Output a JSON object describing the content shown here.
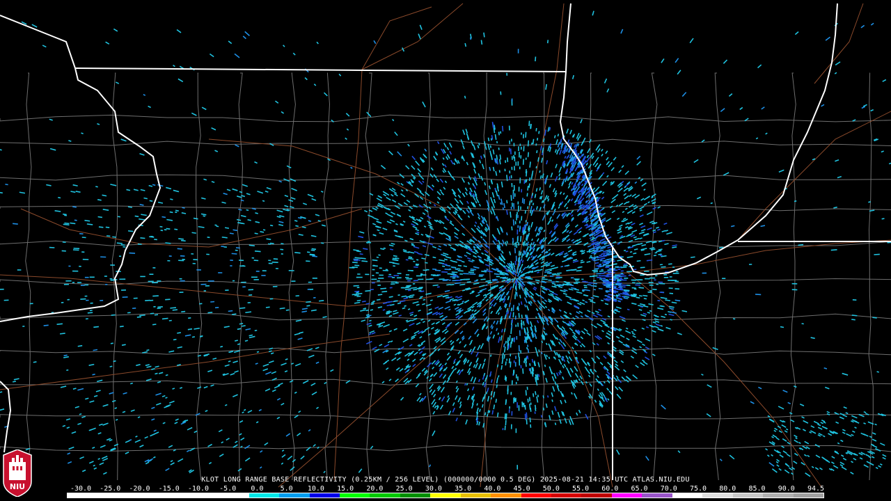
{
  "caption": "KLOT LONG RANGE BASE REFLECTIVITY (0.25KM / 256 LEVEL) (000000/0000 0.5 DEG) 2025-08-21 14:35 UTC  ATLAS.NIU.EDU",
  "scale": {
    "labels": [
      "-30.0",
      "-25.0",
      "-20.0",
      "-15.0",
      "-10.0",
      "-5.0",
      "0.0",
      "5.0",
      "10.0",
      "15.0",
      "20.0",
      "25.0",
      "30.0",
      "35.0",
      "40.0",
      "45.0",
      "50.0",
      "55.0",
      "60.0",
      "65.0",
      "70.0",
      "75.0",
      "80.0",
      "85.0",
      "90.0",
      "94.5"
    ],
    "colors": [
      "#ffffff",
      "#ffffff",
      "#ffffff",
      "#ffffff",
      "#ffffff",
      "#ffffff",
      "#00e8e8",
      "#009ef0",
      "#0000e8",
      "#00ff00",
      "#00c800",
      "#009000",
      "#ffff00",
      "#e8c000",
      "#ff9000",
      "#ff0000",
      "#d60000",
      "#c00000",
      "#ff00ff",
      "#9955c9",
      "#ffffff",
      "#e0e0e0",
      "#c8c8c8",
      "#b0b0b0",
      "#a0a0a0"
    ]
  },
  "logo": {
    "text": "NIU",
    "bg_color": "#c8102e"
  },
  "colors": {
    "state_line": "#ffffff",
    "county_line": "#7a7a7a",
    "road": "#8b4a2b",
    "echo_light": "#1fc3e0",
    "echo_mid": "#1d8fe6",
    "echo_blue": "#2050e0"
  },
  "radar": {
    "site": "KLOT"
  }
}
